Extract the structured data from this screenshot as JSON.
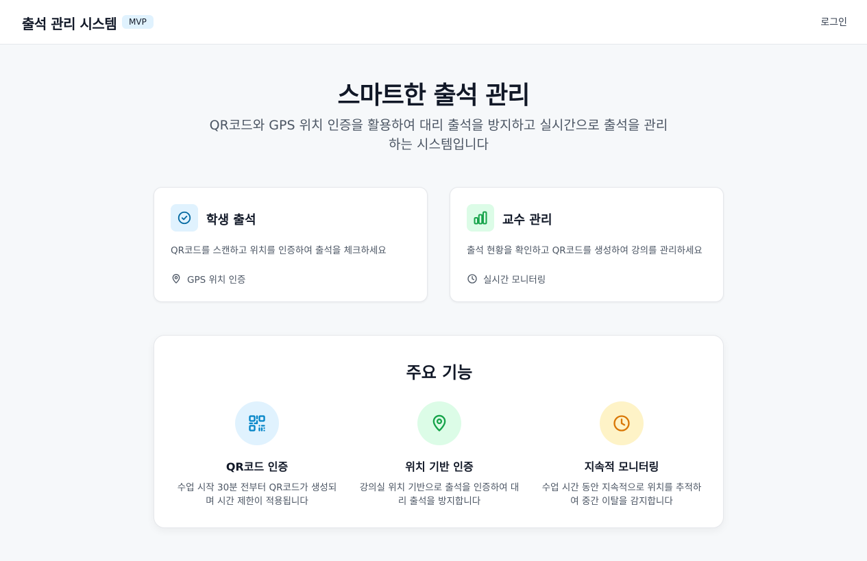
{
  "header": {
    "title": "출석 관리 시스템",
    "badge": "MVP",
    "login_label": "로그인"
  },
  "hero": {
    "title": "스마트한 출석 관리",
    "subtitle": "QR코드와 GPS 위치 인증을 활용하여 대리 출석을 방지하고 실시간으로 출석을 관리하는 시스템입니다"
  },
  "cards": [
    {
      "icon": "check-circle-icon",
      "title": "학생 출석",
      "description": "QR코드를 스캔하고 위치를 인증하여 출석을 체크하세요",
      "footer_icon": "location-pin-icon",
      "footer": "GPS 위치 인증",
      "icon_bg": "#e0f2fe",
      "icon_color": "#0369a1"
    },
    {
      "icon": "bar-chart-icon",
      "title": "교수 관리",
      "description": "출석 현황을 확인하고 QR코드를 생성하여 강의를 관리하세요",
      "footer_icon": "clock-icon",
      "footer": "실시간 모니터링",
      "icon_bg": "#dcfce7",
      "icon_color": "#16a34a"
    }
  ],
  "features": {
    "title": "주요 기능",
    "items": [
      {
        "icon": "qr-code-icon",
        "title": "QR코드 인증",
        "description": "수업 시작 30분 전부터 QR코드가 생성되며 시간 제한이 적용됩니다",
        "icon_bg": "#e0f2fe",
        "icon_color": "#0284c7"
      },
      {
        "icon": "location-pin-icon",
        "title": "위치 기반 인증",
        "description": "강의실 위치 기반으로 출석을 인증하여 대리 출석을 방지합니다",
        "icon_bg": "#dcfce7",
        "icon_color": "#16a34a"
      },
      {
        "icon": "clock-icon",
        "title": "지속적 모니터링",
        "description": "수업 시간 동안 지속적으로 위치를 추적하여 중간 이탈을 감지합니다",
        "icon_bg": "#fef3c7",
        "icon_color": "#d97706"
      }
    ]
  }
}
